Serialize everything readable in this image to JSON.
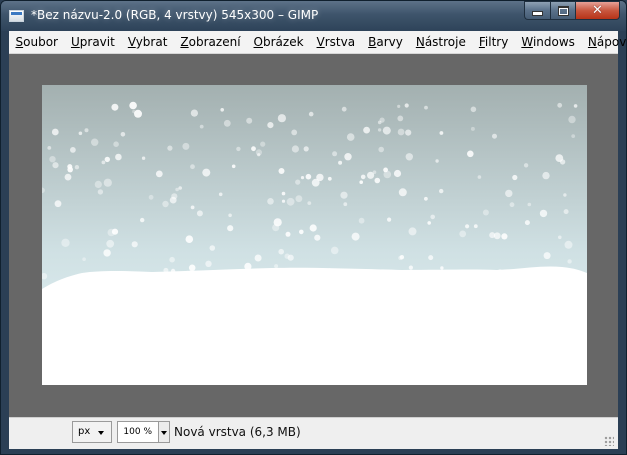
{
  "window": {
    "title": "*Bez názvu-2.0 (RGB, 4 vrstvy) 545x300 – GIMP"
  },
  "menu": [
    {
      "pre": "",
      "acc": "S",
      "post": "oubor"
    },
    {
      "pre": "",
      "acc": "U",
      "post": "pravit"
    },
    {
      "pre": "",
      "acc": "V",
      "post": "ybrat"
    },
    {
      "pre": "",
      "acc": "Z",
      "post": "obrazení"
    },
    {
      "pre": "",
      "acc": "O",
      "post": "brázek"
    },
    {
      "pre": "",
      "acc": "V",
      "post": "rstva"
    },
    {
      "pre": "",
      "acc": "B",
      "post": "arvy"
    },
    {
      "pre": "",
      "acc": "N",
      "post": "ástroje"
    },
    {
      "pre": "",
      "acc": "F",
      "post": "iltry"
    },
    {
      "pre": "",
      "acc": "W",
      "post": "indows"
    },
    {
      "pre": "",
      "acc": "N",
      "post": "ápověda"
    }
  ],
  "status": {
    "unit": "px",
    "zoom": "100 %",
    "layer_info": "Nová vrstva (6,3 MB)"
  },
  "canvas": {
    "image_size": "545x300",
    "sky_top_color": "#a3b0b0",
    "sky_bottom_color": "#dcecef",
    "snow_color": "#ffffff",
    "workspace_color": "#676767"
  }
}
